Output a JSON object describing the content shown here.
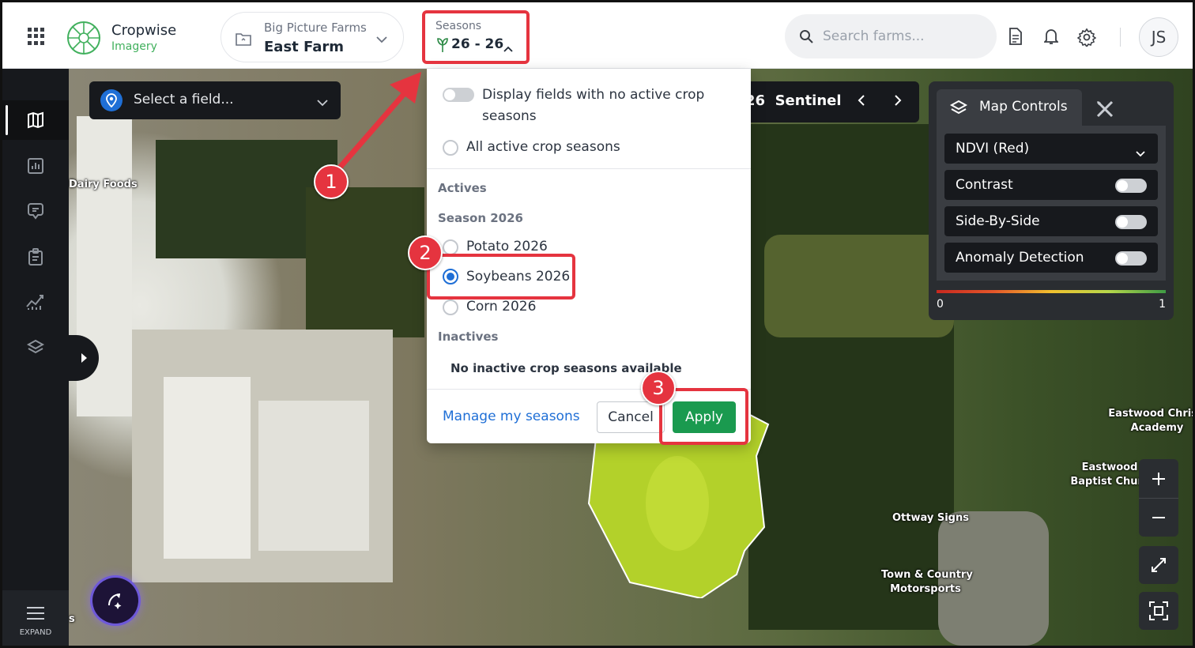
{
  "header": {
    "brand_name": "Cropwise",
    "brand_sub": "Imagery",
    "farm_org": "Big Picture Farms",
    "farm_name": "East Farm",
    "seasons_label": "Seasons",
    "seasons_value": "26 - 26",
    "search_placeholder": "Search farms...",
    "avatar_initials": "JS",
    "icons": [
      "apps-grid-icon",
      "document-icon",
      "bell-icon",
      "gear-icon"
    ]
  },
  "sidebar": {
    "items": [
      {
        "name": "map",
        "icon": "map-icon",
        "active": true
      },
      {
        "name": "reports",
        "icon": "chart-icon",
        "active": false
      },
      {
        "name": "notes",
        "icon": "comment-pin-icon",
        "active": false
      },
      {
        "name": "tasks",
        "icon": "clipboard-icon",
        "active": false
      },
      {
        "name": "analytics",
        "icon": "analytics-icon",
        "active": false
      },
      {
        "name": "layers",
        "icon": "layers-icon",
        "active": false
      }
    ],
    "expand_label": "EXPAND"
  },
  "map": {
    "field_select_placeholder": "Select a field...",
    "sentinel_label": "26  Sentinel",
    "labels": {
      "dairy": "Dairy Foods",
      "christian_academy": "Eastwood Christi\nAcademy",
      "baptist_church": "Eastwood\nBaptist Churc",
      "ottway": "Ottway Signs",
      "motorsports": "Town & Country\nMotorsports",
      "edge_s": "s"
    }
  },
  "map_controls": {
    "tab_label": "Map Controls",
    "index_select": "NDVI (Red)",
    "toggles": [
      {
        "label": "Contrast",
        "on": false
      },
      {
        "label": "Side-By-Side",
        "on": false
      },
      {
        "label": "Anomaly Detection",
        "on": false
      }
    ],
    "scale_min": "0",
    "scale_max": "1",
    "scale_colors": [
      "#c7281f",
      "#e5572a",
      "#f2c12e",
      "#b7d84b",
      "#3e9b44"
    ]
  },
  "seasons_dropdown": {
    "toggle_label": "Display fields with no active crop seasons",
    "toggle_on": false,
    "all_active_label": "All active crop seasons",
    "actives_header": "Actives",
    "season_group": "Season 2026",
    "options": [
      {
        "label": "Potato 2026",
        "checked": false
      },
      {
        "label": "Soybeans 2026",
        "checked": true
      },
      {
        "label": "Corn 2026",
        "checked": false
      }
    ],
    "inactives_header": "Inactives",
    "no_inactive_text": "No inactive crop seasons available",
    "manage_link": "Manage my seasons",
    "cancel_label": "Cancel",
    "apply_label": "Apply"
  },
  "annotations": {
    "steps": [
      "1",
      "2",
      "3"
    ],
    "color": "#e5343f"
  }
}
